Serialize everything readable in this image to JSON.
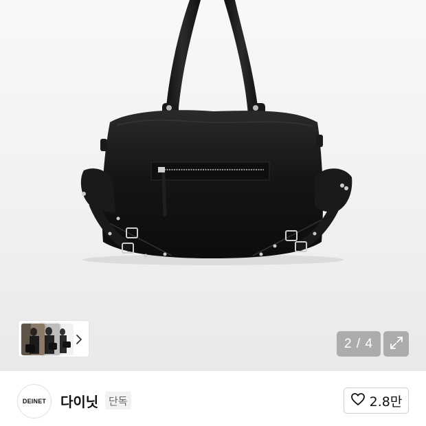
{
  "gallery": {
    "image_alt": "black leather shoulder bag with buckles",
    "current_page": "2",
    "total_pages": "4",
    "pager_text": "2 / 4",
    "thumbnails_count": 3,
    "icons": {
      "next": "chevron-right-icon",
      "expand": "expand-icon"
    }
  },
  "brand": {
    "logo_text": "DEINET",
    "name": "다이닛",
    "badge": "단독"
  },
  "like": {
    "icon": "heart-icon",
    "count": "2.8만"
  },
  "colors": {
    "bag": "#141414",
    "hardware": "#c9c9c9",
    "pager_bg": "#8c8c8c",
    "text": "#111111"
  }
}
